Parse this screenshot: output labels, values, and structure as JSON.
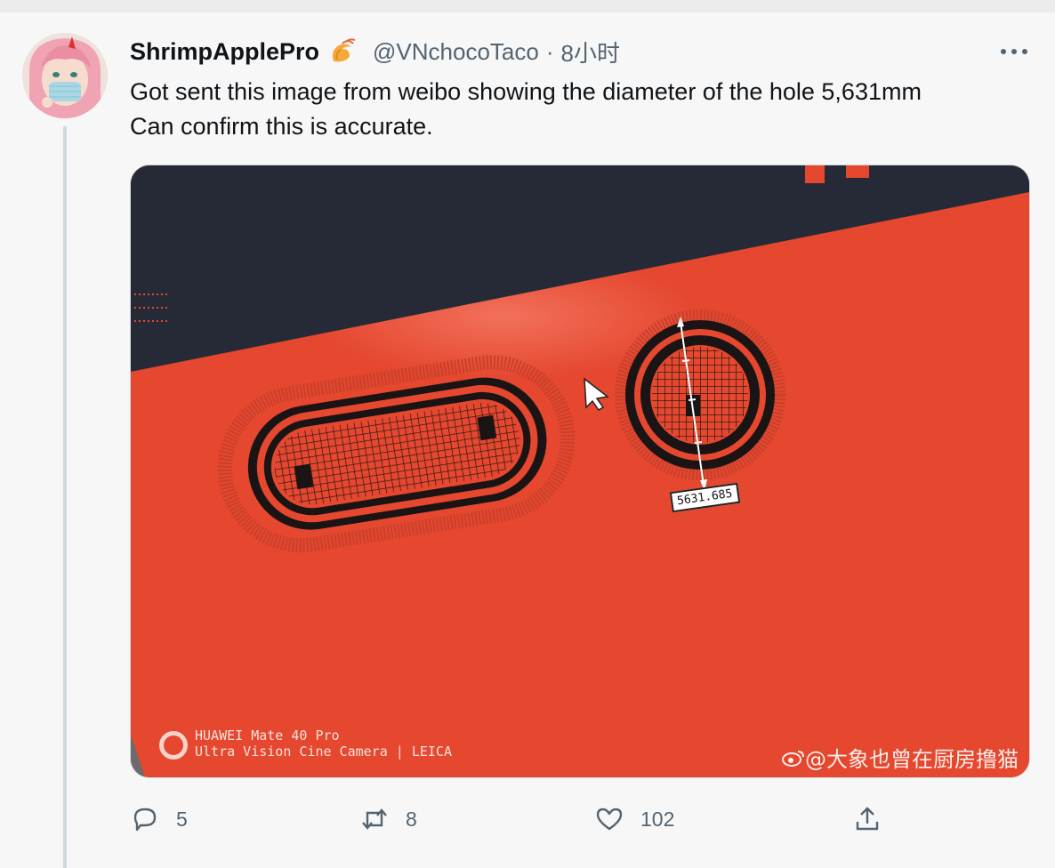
{
  "tweet": {
    "author_name": "ShrimpApplePro",
    "author_handle": "@VNchocoTaco",
    "separator": "·",
    "time": "8小时",
    "text_line1": "Got sent this image from weibo showing the diameter of the hole 5,631mm",
    "text_line2": "Can confirm this is accurate."
  },
  "media": {
    "measurement": "5631.685",
    "camera_line1": "HUAWEI Mate 40 Pro",
    "camera_line2": "Ultra Vision Cine Camera | LEICA",
    "weibo_mark": "@大象也曾在厨房撸猫"
  },
  "actions": {
    "reply_count": "5",
    "retweet_count": "8",
    "like_count": "102"
  },
  "icons": {
    "badge": "shrimp-emoji-icon",
    "more": "more-options-icon",
    "reply": "reply-icon",
    "retweet": "retweet-icon",
    "like": "heart-icon",
    "share": "share-icon"
  },
  "colors": {
    "text_primary": "#0f1419",
    "text_secondary": "#536471",
    "thread_line": "#cfd9de",
    "media_orange": "#e84c33",
    "media_dark": "#262a36"
  }
}
